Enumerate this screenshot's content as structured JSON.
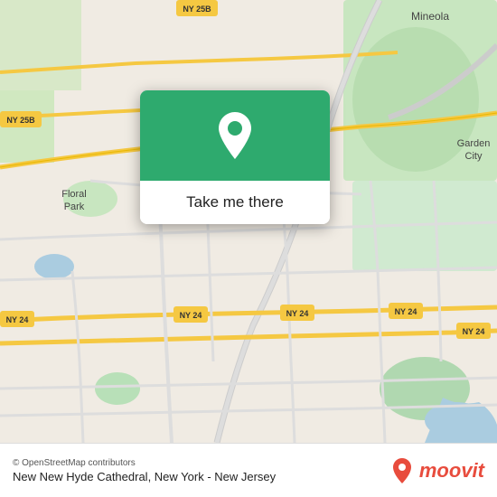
{
  "map": {
    "attribution": "© OpenStreetMap contributors",
    "background_color": "#e8e0d8"
  },
  "popup": {
    "button_label": "Take me there",
    "pin_color": "white"
  },
  "bottom_bar": {
    "location_title": "New New Hyde Cathedral, New York - New Jersey",
    "moovit_label": "moovit"
  }
}
